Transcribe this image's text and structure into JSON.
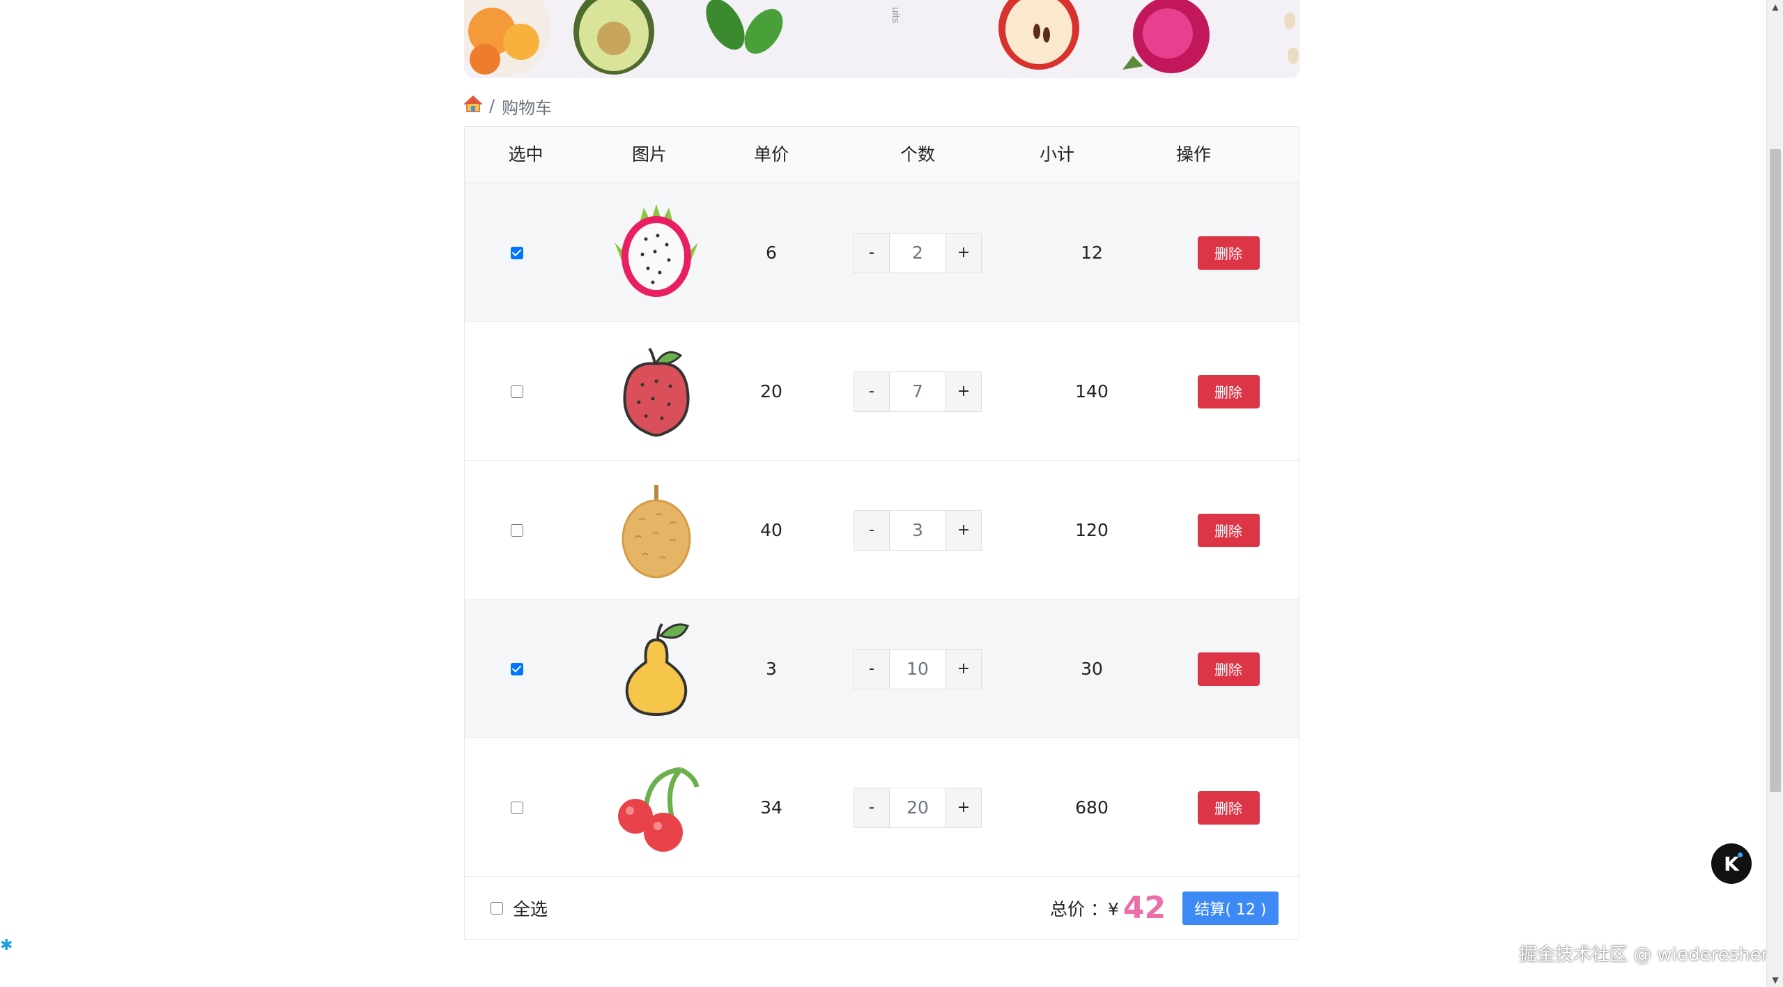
{
  "banner": {
    "side_text": "uits"
  },
  "breadcrumb": {
    "home_icon": "home-icon",
    "separator": "/",
    "current": "购物车"
  },
  "table": {
    "headers": [
      "选中",
      "图片",
      "单价",
      "个数",
      "小计",
      "操作"
    ],
    "rows": [
      {
        "checked": true,
        "fruit": "dragon-fruit-icon",
        "price": "6",
        "qty": "2",
        "subtotal": "12",
        "minus": "-",
        "plus": "+",
        "delete": "删除"
      },
      {
        "checked": false,
        "fruit": "lychee-icon",
        "price": "20",
        "qty": "7",
        "subtotal": "140",
        "minus": "-",
        "plus": "+",
        "delete": "删除"
      },
      {
        "checked": false,
        "fruit": "durian-icon",
        "price": "40",
        "qty": "3",
        "subtotal": "120",
        "minus": "-",
        "plus": "+",
        "delete": "删除"
      },
      {
        "checked": true,
        "fruit": "pear-icon",
        "price": "3",
        "qty": "10",
        "subtotal": "30",
        "minus": "-",
        "plus": "+",
        "delete": "删除"
      },
      {
        "checked": false,
        "fruit": "cherry-icon",
        "price": "34",
        "qty": "20",
        "subtotal": "680",
        "minus": "-",
        "plus": "+",
        "delete": "删除"
      }
    ]
  },
  "footer": {
    "select_all": "全选",
    "select_all_checked": false,
    "total_label": "总价 ：¥",
    "total_value": "42",
    "checkout": "结算( 12 )"
  },
  "watermark": "掘金技术社区 @ wiedereshen",
  "float_button": "K",
  "colors": {
    "delete": "#dc3545",
    "checkout": "#3d8af7",
    "total": "#ec6fa8",
    "checkbox": "#0075ff"
  }
}
